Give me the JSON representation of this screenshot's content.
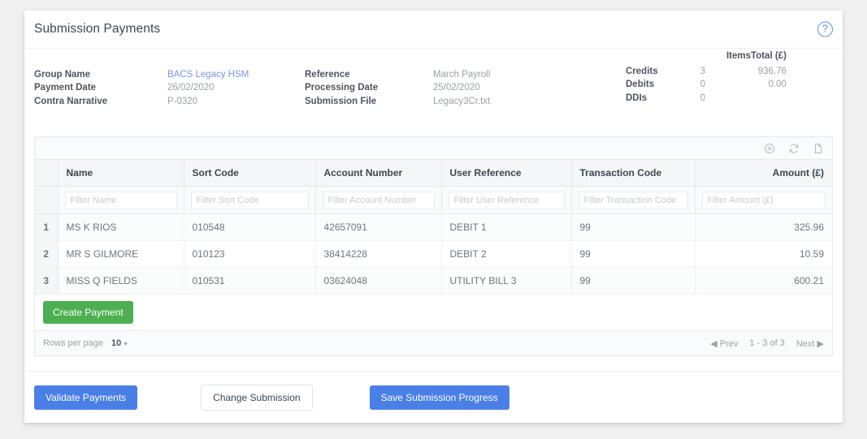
{
  "header": {
    "title": "Submission Payments",
    "help_icon": "question-circle-icon",
    "help_glyph": "?"
  },
  "summary": {
    "left": [
      {
        "label": "Group Name",
        "value": "BACS Legacy HSM",
        "is_link": true
      },
      {
        "label": "Payment Date",
        "value": "26/02/2020",
        "is_link": false
      },
      {
        "label": "Contra Narrative",
        "value": "P-0320",
        "is_link": false
      }
    ],
    "middle": [
      {
        "label": "Reference",
        "value": "March Payroll"
      },
      {
        "label": "Processing Date",
        "value": "25/02/2020"
      },
      {
        "label": "Submission File",
        "value": "Legacy3Cr.txt"
      }
    ],
    "totals": {
      "col_items": "Items",
      "col_total": "Total (£)",
      "rows": [
        {
          "label": "Credits",
          "items": "3",
          "total": "936.76"
        },
        {
          "label": "Debits",
          "items": "0",
          "total": "0.00"
        },
        {
          "label": "DDIs",
          "items": "0",
          "total": ""
        }
      ]
    }
  },
  "toolbar": {
    "add_icon": "plus-circle-icon",
    "refresh_icon": "refresh-icon",
    "file_icon": "file-icon"
  },
  "table": {
    "columns": [
      {
        "key": "idx",
        "label": "",
        "align": "center"
      },
      {
        "key": "name",
        "label": "Name",
        "align": "left"
      },
      {
        "key": "sort_code",
        "label": "Sort Code",
        "align": "left"
      },
      {
        "key": "account_number",
        "label": "Account Number",
        "align": "left"
      },
      {
        "key": "user_reference",
        "label": "User Reference",
        "align": "left"
      },
      {
        "key": "transaction_code",
        "label": "Transaction Code",
        "align": "left"
      },
      {
        "key": "amount",
        "label": "Amount (£)",
        "align": "right"
      }
    ],
    "filters": {
      "name": "Filter Name",
      "sort_code": "Filter Sort Code",
      "account_number": "Filter Account Number",
      "user_reference": "Filter User Reference",
      "transaction_code": "Filter Transaction Code",
      "amount": "Filter Amount (£)"
    },
    "rows": [
      {
        "idx": "1",
        "name": "MS K RIOS",
        "sort_code": "010548",
        "account_number": "42657091",
        "user_reference": "DEBIT 1",
        "transaction_code": "99",
        "amount": "325.96"
      },
      {
        "idx": "2",
        "name": "MR S GILMORE",
        "sort_code": "010123",
        "account_number": "38414228",
        "user_reference": "DEBIT 2",
        "transaction_code": "99",
        "amount": "10.59"
      },
      {
        "idx": "3",
        "name": "MISS Q FIELDS",
        "sort_code": "010531",
        "account_number": "03624048",
        "user_reference": "UTILITY BILL 3",
        "transaction_code": "99",
        "amount": "600.21"
      }
    ]
  },
  "create_payment": {
    "label": "Create Payment"
  },
  "pager": {
    "rows_per_page_label": "Rows per page",
    "rows_per_page_value": "10",
    "caret": "▼",
    "prev": "Prev",
    "prev_arrow": "◀",
    "range": "1 - 3 of 3",
    "next": "Next",
    "next_arrow": "▶"
  },
  "footer": {
    "validate": "Validate Payments",
    "change": "Change Submission",
    "save": "Save Submission Progress"
  },
  "colors": {
    "primary_blue": "#4a7fe8",
    "green": "#4caf50",
    "link_blue": "#7a96e8",
    "page_bg": "#f0f0f0"
  }
}
